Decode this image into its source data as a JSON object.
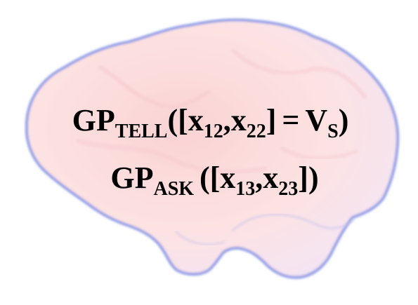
{
  "colors": {
    "brain_fill": "#fbdada",
    "brain_outline": "#8f9be6"
  },
  "tell": {
    "name": "GP",
    "subscript": "TELL",
    "open": "([",
    "x1": "x",
    "x1_sub": "12",
    "comma": ",",
    "x2": "x",
    "x2_sub": "22",
    "close_bracket": "]",
    "equals": "=",
    "value": "V",
    "value_sub": "S",
    "close": ")"
  },
  "ask": {
    "name": "GP",
    "subscript": "ASK",
    "open": "([",
    "x1": "x",
    "x1_sub": "13",
    "comma": ",",
    "x2": "x",
    "x2_sub": "23",
    "close": "])"
  }
}
